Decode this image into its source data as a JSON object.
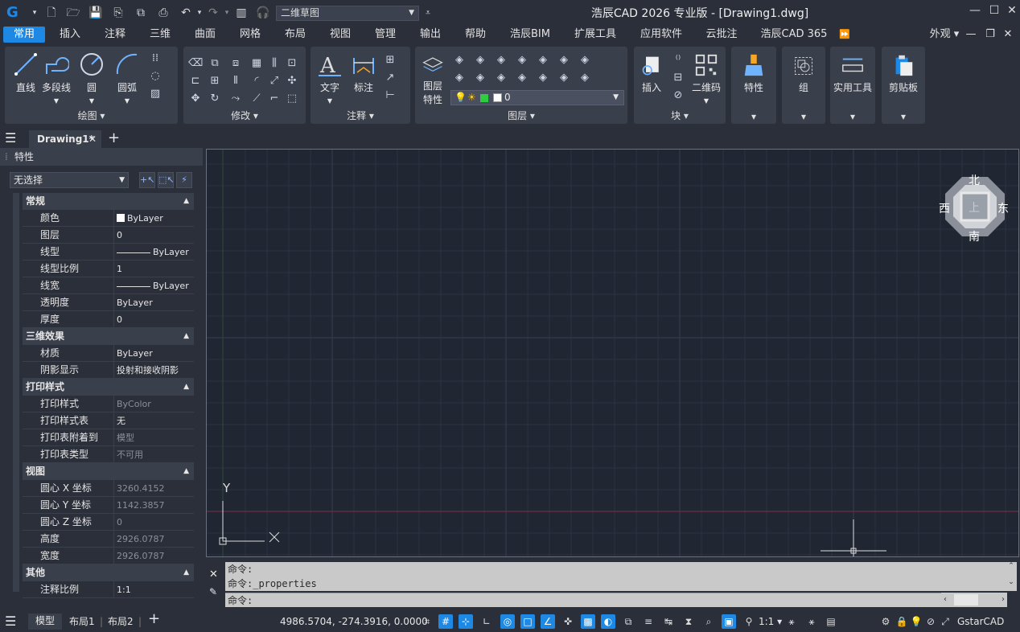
{
  "app": {
    "title": "浩辰CAD 2026 专业版 - [Drawing1.dwg]",
    "workspace": "二维草图"
  },
  "menu_tabs": [
    "常用",
    "插入",
    "注释",
    "三维",
    "曲面",
    "网格",
    "布局",
    "视图",
    "管理",
    "输出",
    "帮助",
    "浩辰BIM",
    "扩展工具",
    "应用软件",
    "云批注",
    "浩辰CAD 365"
  ],
  "appearance_label": "外观",
  "ribbon": {
    "draw": {
      "title": "绘图",
      "line": "直线",
      "polyline": "多段线",
      "circle": "圆",
      "arc": "圆弧"
    },
    "modify": {
      "title": "修改"
    },
    "annotation": {
      "title": "注释",
      "text": "文字",
      "dimension": "标注"
    },
    "layers": {
      "title": "图层",
      "layer_props_1": "图层",
      "layer_props_2": "特性",
      "current_layer": "0"
    },
    "block": {
      "title": "块",
      "insert": "插入",
      "qrcode": "二维码"
    },
    "properties": {
      "label": "特性"
    },
    "group": {
      "label": "组"
    },
    "utilities": {
      "label": "实用工具"
    },
    "clipboard": {
      "label": "剪贴板"
    }
  },
  "document_tab": "Drawing1*",
  "properties_panel": {
    "title": "特性",
    "selection": "无选择",
    "sections": [
      {
        "title": "常规",
        "rows": [
          [
            "颜色",
            "ByLayer"
          ],
          [
            "图层",
            "0"
          ],
          [
            "线型",
            "ByLayer"
          ],
          [
            "线型比例",
            "1"
          ],
          [
            "线宽",
            "ByLayer"
          ],
          [
            "透明度",
            "ByLayer"
          ],
          [
            "厚度",
            "0"
          ]
        ]
      },
      {
        "title": "三维效果",
        "rows": [
          [
            "材质",
            "ByLayer"
          ],
          [
            "阴影显示",
            "投射和接收阴影"
          ]
        ]
      },
      {
        "title": "打印样式",
        "rows": [
          [
            "打印样式",
            "ByColor"
          ],
          [
            "打印样式表",
            "无"
          ],
          [
            "打印表附着到",
            "模型"
          ],
          [
            "打印表类型",
            "不可用"
          ]
        ]
      },
      {
        "title": "视图",
        "rows": [
          [
            "圆心 X 坐标",
            "3260.4152"
          ],
          [
            "圆心 Y 坐标",
            "1142.3857"
          ],
          [
            "圆心 Z 坐标",
            "0"
          ],
          [
            "高度",
            "2926.0787"
          ],
          [
            "宽度",
            "2926.0787"
          ]
        ]
      },
      {
        "title": "其他",
        "rows": [
          [
            "注释比例",
            "1:1"
          ]
        ]
      }
    ]
  },
  "viewcube": {
    "north": "北",
    "south": "南",
    "east": "东",
    "west": "西",
    "top": "上"
  },
  "ucs": {
    "x": "X",
    "y": "Y"
  },
  "command": {
    "line1": "命令:",
    "line2": "命令:_properties",
    "prompt": "命令:"
  },
  "status": {
    "model": "模型",
    "layout1": "布局1",
    "layout2": "布局2",
    "coords": "4986.5704, -274.3916, 0.0000",
    "scale": "1:1",
    "brand": "GstarCAD"
  },
  "colors": {
    "accent": "#1e88e5",
    "canvas": "#212633",
    "panel": "#2b2f3a"
  }
}
